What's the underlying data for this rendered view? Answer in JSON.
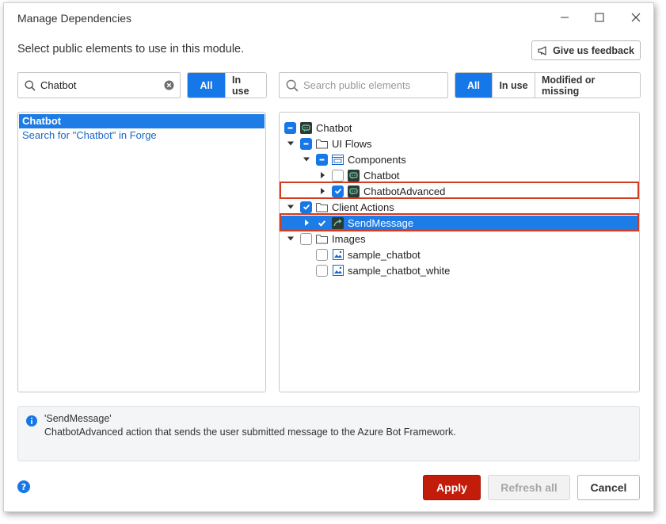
{
  "window": {
    "title": "Manage Dependencies"
  },
  "header": {
    "subtitle": "Select public elements to use in this module.",
    "feedback_label": "Give us feedback"
  },
  "left": {
    "search_value": "Chatbot",
    "filters": [
      "All",
      "In use"
    ],
    "active_filter": "All",
    "results": [
      {
        "label": "Chatbot",
        "selected": true
      },
      {
        "label": "Search for \"Chatbot\" in Forge",
        "selected": false
      }
    ]
  },
  "right": {
    "search_placeholder": "Search public elements",
    "filters": [
      "All",
      "In use",
      "Modified or missing"
    ],
    "active_filter": "All",
    "tree": {
      "root": "Chatbot",
      "ui_flows": "UI Flows",
      "components": "Components",
      "comp_chatbot": "Chatbot",
      "comp_chatbot_advanced": "ChatbotAdvanced",
      "client_actions": "Client Actions",
      "send_message": "SendMessage",
      "images": "Images",
      "img_sample_chatbot": "sample_chatbot",
      "img_sample_chatbot_white": "sample_chatbot_white"
    }
  },
  "info": {
    "title": "'SendMessage'",
    "description": "ChatbotAdvanced action that sends the user submitted message to the Azure Bot Framework."
  },
  "footer": {
    "apply_label": "Apply",
    "refresh_label": "Refresh all",
    "cancel_label": "Cancel"
  },
  "colors": {
    "accent": "#1677e8",
    "apply": "#c21c0a",
    "highlight_border": "#d23b1f"
  }
}
